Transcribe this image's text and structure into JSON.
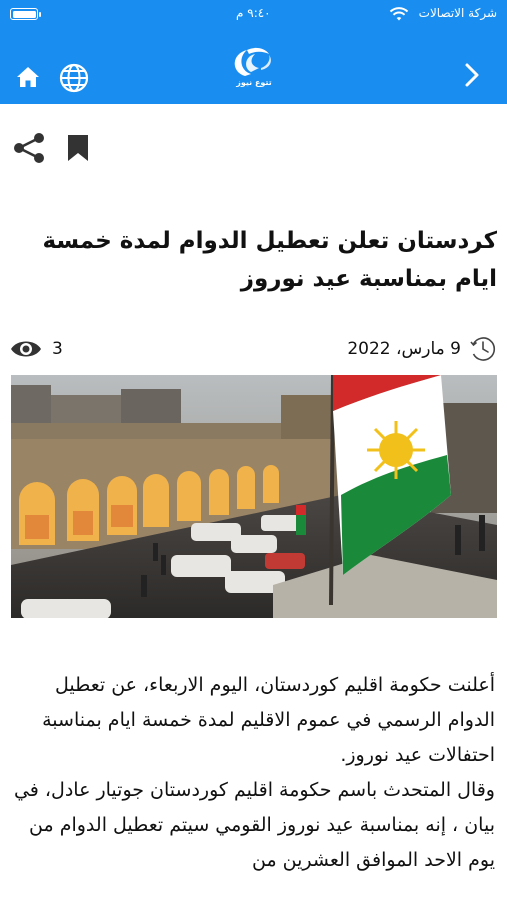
{
  "status_bar": {
    "carrier": "شركة الاتصالات",
    "time": "٩:٤٠ م"
  },
  "header": {
    "logo_text": "تتوع نيوز"
  },
  "article": {
    "title": "كردستان تعلن تعطيل الدوام لمدة خمسة ايام بمناسبة عيد نوروز",
    "views": "3",
    "date": "9 مارس، 2022",
    "paragraphs": [
      "أعلنت حكومة اقليم كوردستان، اليوم الاربعاء، عن تعطيل الدوام الرسمي في عموم الاقليم لمدة خمسة ايام بمناسبة احتفالات عيد نوروز.",
      "وقال المتحدث باسم حكومة اقليم كوردستان جوتيار عادل، في بيان ، إنه بمناسبة عيد نوروز القومي سيتم تعطيل الدوام من يوم الاحد الموافق العشرين من"
    ]
  },
  "icons": {
    "home": "home-icon",
    "globe": "globe-icon",
    "next": "chevron-right-icon",
    "share": "share-icon",
    "bookmark": "bookmark-icon",
    "views": "eye-icon",
    "date": "clock-icon",
    "wifi": "wifi-icon",
    "battery": "battery-icon"
  },
  "colors": {
    "header_bg": "#1a8ef0",
    "text": "#111111",
    "icon": "#333333"
  }
}
